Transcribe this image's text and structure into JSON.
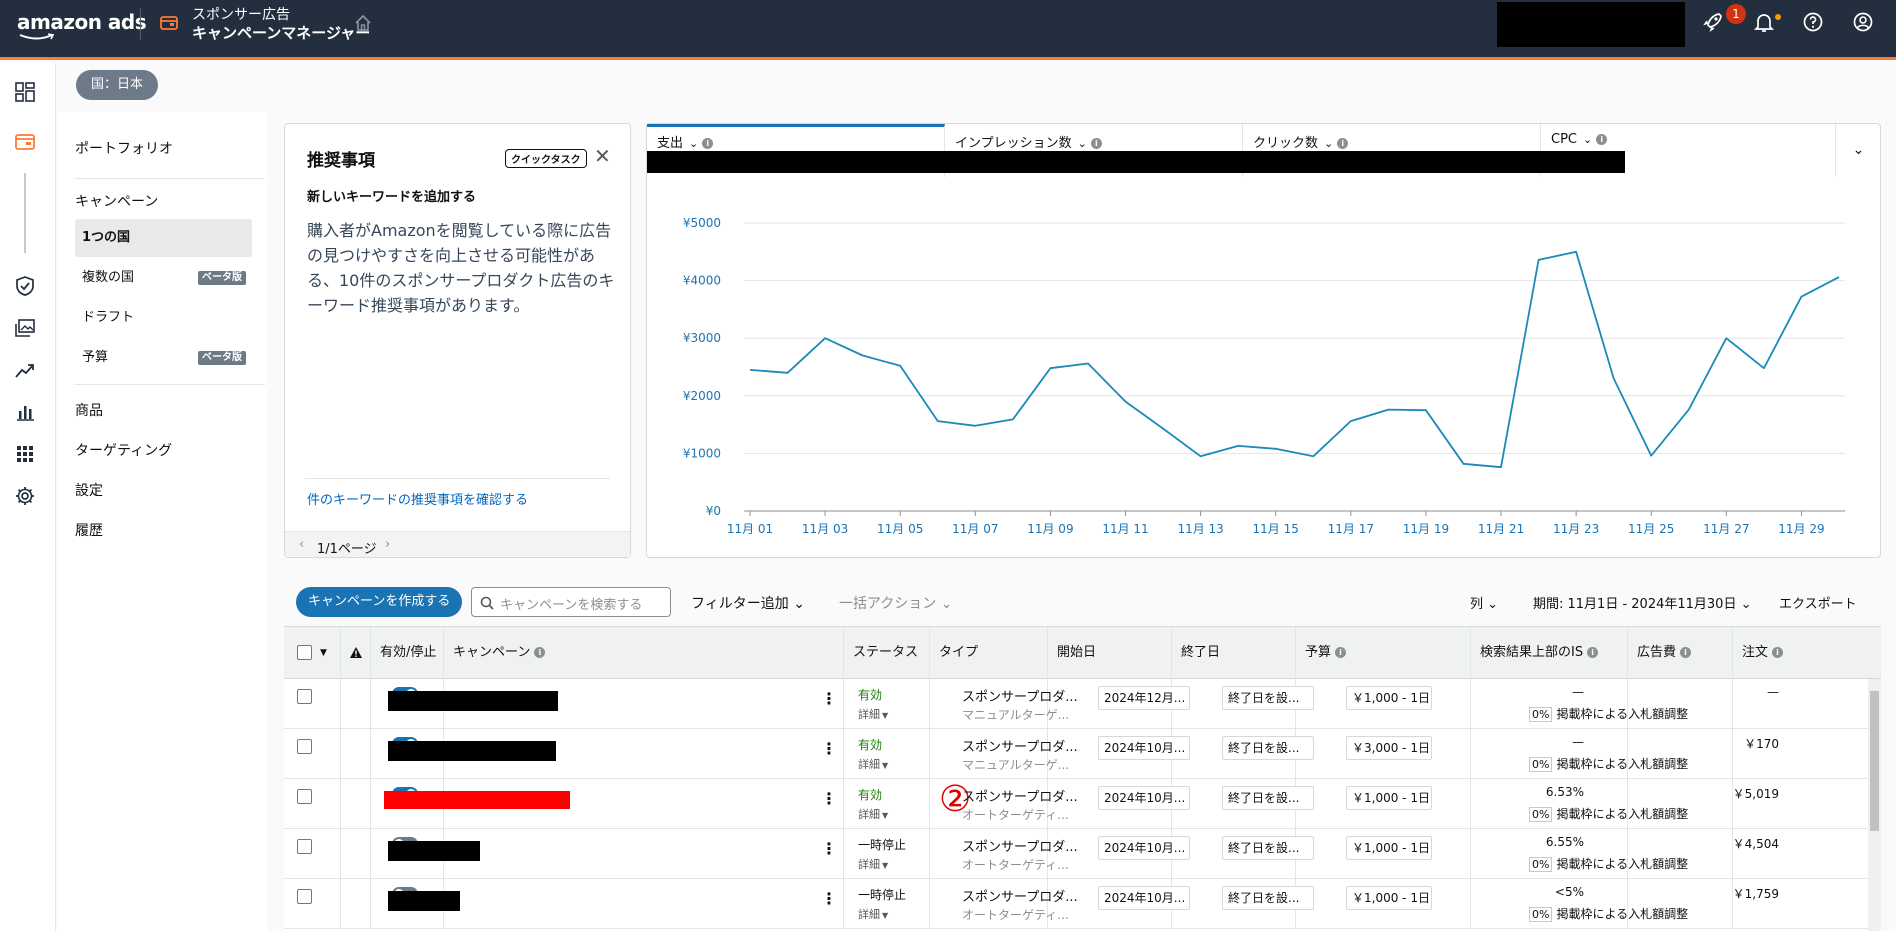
{
  "header": {
    "logo_text": "amazon ads",
    "app_line1": "スポンサー広告",
    "app_line2": "キャンペーンマネージャー",
    "notification_count": "1"
  },
  "filter": {
    "country_chip": "国：日本"
  },
  "sidebar": {
    "portfolio": "ポートフォリオ",
    "campaigns": "キャンペーン",
    "sub_items": [
      {
        "label": "1つの国",
        "active": true
      },
      {
        "label": "複数の国",
        "badge": "ベータ版"
      },
      {
        "label": "ドラフト"
      },
      {
        "label": "予算",
        "badge": "ベータ版"
      }
    ],
    "products": "商品",
    "targeting": "ターゲティング",
    "settings": "設定",
    "history": "履歴"
  },
  "recommendation": {
    "title": "推奨事項",
    "tag": "クイックタスク",
    "subtitle": "新しいキーワードを追加する",
    "body": "購入者がAmazonを閲覧している際に広告の見つけやすさを向上させる可能性がある、10件のスポンサープロダクト広告のキーワード推奨事項があります。",
    "link": "件のキーワードの推奨事項を確認する",
    "pagination": "1/1ページ"
  },
  "metrics": {
    "tabs": [
      "支出",
      "インプレッション数",
      "クリック数",
      "CPC"
    ]
  },
  "chart_data": {
    "type": "line",
    "x": [
      "11月 01",
      "11月 02",
      "11月 03",
      "11月 04",
      "11月 05",
      "11月 06",
      "11月 07",
      "11月 08",
      "11月 09",
      "11月 10",
      "11月 11",
      "11月 12",
      "11月 13",
      "11月 14",
      "11月 15",
      "11月 16",
      "11月 17",
      "11月 18",
      "11月 19",
      "11月 20",
      "11月 21",
      "11月 22",
      "11月 23",
      "11月 24",
      "11月 25",
      "11月 26",
      "11月 27",
      "11月 28",
      "11月 29",
      "11月 30"
    ],
    "tick_labels": [
      "11月 01",
      "11月 03",
      "11月 05",
      "11月 07",
      "11月 09",
      "11月 11",
      "11月 13",
      "11月 15",
      "11月 17",
      "11月 19",
      "11月 21",
      "11月 23",
      "11月 25",
      "11月 27",
      "11月 29"
    ],
    "values": [
      2450,
      2400,
      3000,
      2700,
      2520,
      1560,
      1480,
      1590,
      2480,
      2560,
      1900,
      1430,
      950,
      1130,
      1080,
      950,
      1560,
      1760,
      1750,
      820,
      760,
      4360,
      4500,
      2300,
      960,
      1760,
      3000,
      2480,
      3720,
      4060
    ],
    "y_ticks": [
      "¥0",
      "¥1000",
      "¥2000",
      "¥3000",
      "¥4000",
      "¥5000"
    ],
    "ylim": [
      0,
      5000
    ],
    "grid": true,
    "color": "#1b8ab8"
  },
  "toolbar": {
    "create_button": "キャンペーンを作成する",
    "search_placeholder": "キャンペーンを検索する",
    "add_filter": "フィルター追加",
    "bulk_actions": "一括アクション",
    "columns": "列",
    "date_range": "期間: 11月1日 - 2024年11月30日",
    "export": "エクスポート"
  },
  "table": {
    "headers": {
      "active": "有効/停止",
      "campaign": "キャンペーン",
      "status": "ステータス",
      "type": "タイプ",
      "start": "開始日",
      "end": "終了日",
      "budget": "予算",
      "top_is": "検索結果上部のIS",
      "spend": "広告費",
      "orders": "注文"
    },
    "rows": [
      {
        "on": true,
        "status": "有効",
        "status_ok": true,
        "detail": "詳細",
        "type": "スポンサープロダ...",
        "type_sub": "マニュアルターゲ...",
        "start": "2024年12月...",
        "end": "終了日を設...",
        "budget": "￥1,000 - 1日",
        "is": "—",
        "adj_pct": "0%",
        "adj_label": "掲載枠による入札額調整",
        "spend": "—"
      },
      {
        "on": true,
        "status": "有効",
        "status_ok": true,
        "detail": "詳細",
        "type": "スポンサープロダ...",
        "type_sub": "マニュアルターゲ...",
        "start": "2024年10月...",
        "end": "終了日を設...",
        "budget": "￥3,000 - 1日",
        "is": "—",
        "adj_pct": "0%",
        "adj_label": "掲載枠による入札額調整",
        "spend": "￥170"
      },
      {
        "on": true,
        "status": "有効",
        "status_ok": true,
        "detail": "詳細",
        "type": "スポンサープロダ...",
        "type_sub": "オートターゲティ...",
        "start": "2024年10月...",
        "end": "終了日を設...",
        "budget": "￥1,000 - 1日",
        "is": "6.53%",
        "adj_pct": "0%",
        "adj_label": "掲載枠による入札額調整",
        "spend": "￥5,019"
      },
      {
        "on": false,
        "status": "一時停止",
        "status_ok": false,
        "detail": "詳細",
        "type": "スポンサープロダ...",
        "type_sub": "オートターゲティ...",
        "start": "2024年10月...",
        "end": "終了日を設...",
        "budget": "￥1,000 - 1日",
        "is": "6.55%",
        "adj_pct": "0%",
        "adj_label": "掲載枠による入札額調整",
        "spend": "￥4,504"
      },
      {
        "on": false,
        "status": "一時停止",
        "status_ok": false,
        "detail": "詳細",
        "type": "スポンサープロダ...",
        "type_sub": "オートターゲティ...",
        "start": "2024年10月...",
        "end": "終了日を設...",
        "budget": "￥1,000 - 1日",
        "is": "<5%",
        "adj_pct": "0%",
        "adj_label": "掲載枠による入札額調整",
        "spend": "￥1,759"
      }
    ],
    "marker": "②"
  }
}
